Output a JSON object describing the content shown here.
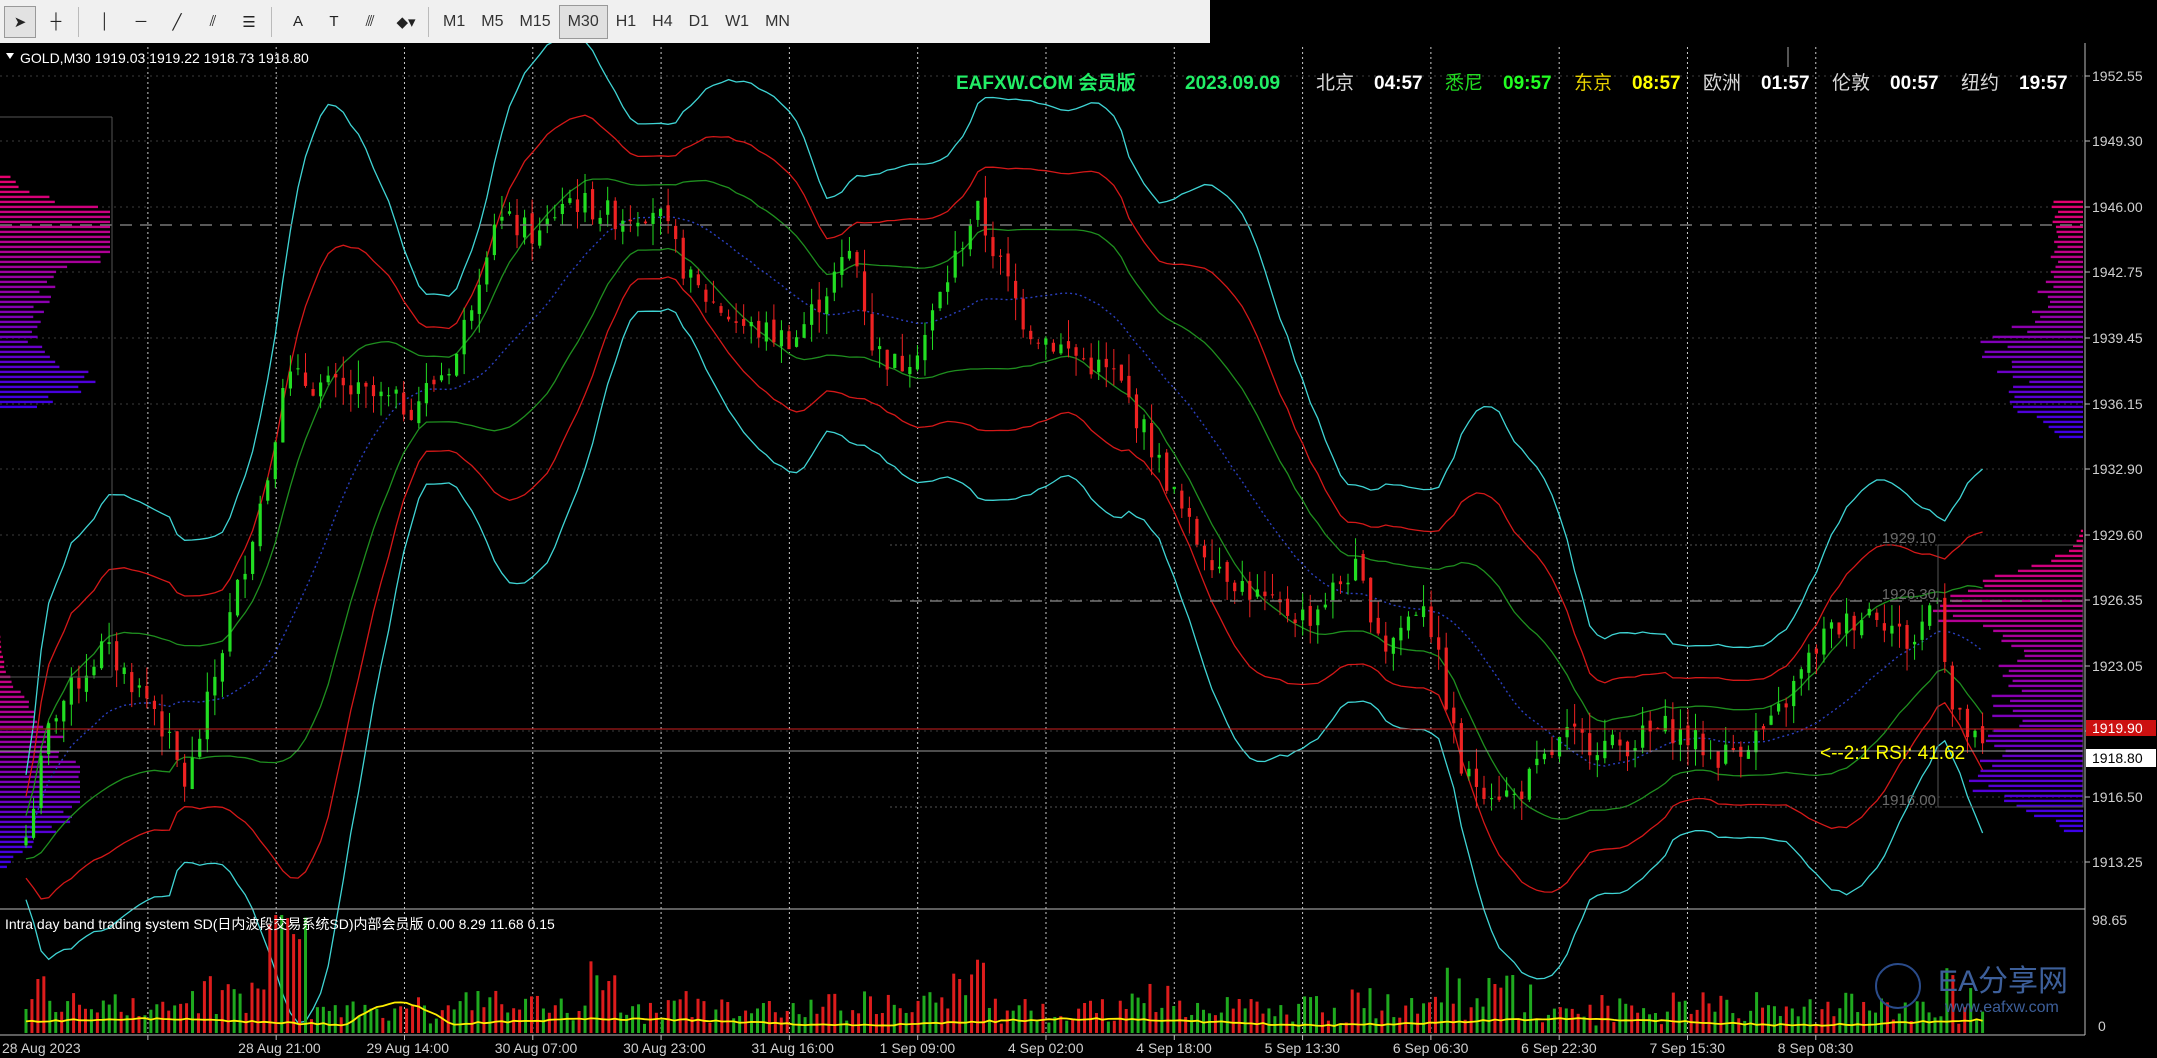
{
  "toolbar": {
    "tools": [
      {
        "name": "cursor-arrow-icon",
        "glyph": "➤"
      },
      {
        "name": "crosshair-icon",
        "glyph": "┼"
      },
      {
        "name": "vertical-line-icon",
        "glyph": "│"
      },
      {
        "name": "horizontal-line-icon",
        "glyph": "─"
      },
      {
        "name": "trendline-icon",
        "glyph": "╱"
      },
      {
        "name": "equidistant-channel-icon",
        "glyph": "⫽"
      },
      {
        "name": "fibonacci-icon",
        "glyph": "☰"
      },
      {
        "name": "text-icon",
        "glyph": "A"
      },
      {
        "name": "text-label-icon",
        "glyph": "T"
      },
      {
        "name": "parallel-lines-icon",
        "glyph": "⫻"
      },
      {
        "name": "shapes-menu-icon",
        "glyph": "◆▾"
      }
    ],
    "timeframes": [
      "M1",
      "M5",
      "M15",
      "M30",
      "H1",
      "H4",
      "D1",
      "W1",
      "MN"
    ],
    "active_timeframe": "M30"
  },
  "chart": {
    "header": "GOLD,M30  1919.03 1919.22 1918.73 1918.80",
    "brand": "EAFXW.COM 会员版",
    "date": "2023.09.09",
    "clocks": [
      {
        "city": "北京",
        "time": "04:57",
        "city_color": "#d8d8d8",
        "time_color": "#ffffff"
      },
      {
        "city": "悉尼",
        "time": "09:57",
        "city_color": "#22dd22",
        "time_color": "#22ff22"
      },
      {
        "city": "东京",
        "time": "08:57",
        "city_color": "#e6d000",
        "time_color": "#ffff00"
      },
      {
        "city": "欧洲",
        "time": "01:57",
        "city_color": "#d8d8d8",
        "time_color": "#ffffff"
      },
      {
        "city": "伦敦",
        "time": "00:57",
        "city_color": "#d8d8d8",
        "time_color": "#ffffff"
      },
      {
        "city": "纽约",
        "time": "19:57",
        "city_color": "#d8d8d8",
        "time_color": "#ffffff"
      }
    ],
    "rsi_label": "<--2:1  RSI: 41.62",
    "current_price": "1918.80",
    "red_price_tag": "1919.90",
    "level_labels": [
      "1929.10",
      "1926.30",
      "1916.00"
    ],
    "indicator_title": "Intra day band trading system SD(日内波段交易系统SD)内部会员版 0.00 8.29 11.68 0.15",
    "indicator_max": "98.65",
    "indicator_min": "0",
    "watermark_title": "EA分享网",
    "watermark_url": "www.eafxw.com"
  },
  "chart_data": {
    "type": "candlestick",
    "symbol": "GOLD",
    "timeframe": "M30",
    "ohlc_last": {
      "open": 1919.03,
      "high": 1919.22,
      "low": 1918.73,
      "close": 1918.8
    },
    "y_ticks": [
      1952.55,
      1949.3,
      1946.0,
      1942.75,
      1939.45,
      1936.15,
      1932.9,
      1929.6,
      1926.35,
      1923.05,
      1919.8,
      1916.5,
      1913.25
    ],
    "ylim": [
      1911.0,
      1954.0
    ],
    "x_ticks": [
      "28 Aug 2023",
      "28 Aug 21:00",
      "29 Aug 14:00",
      "30 Aug 07:00",
      "30 Aug 23:00",
      "31 Aug 16:00",
      "1 Sep 09:00",
      "4 Sep 02:00",
      "4 Sep 18:00",
      "5 Sep 13:30",
      "6 Sep 06:30",
      "6 Sep 22:30",
      "7 Sep 15:30",
      "8 Sep 08:30"
    ],
    "horizontal_levels": [
      1945.1,
      1926.3,
      1919.9,
      1918.8
    ],
    "price_path": [
      [
        0,
        1914.5
      ],
      [
        0.2,
        1920.5
      ],
      [
        0.6,
        1924.0
      ],
      [
        1.0,
        1921.0
      ],
      [
        1.25,
        1917.0
      ],
      [
        1.55,
        1924.5
      ],
      [
        1.9,
        1933.0
      ],
      [
        2.0,
        1937.5
      ],
      [
        2.5,
        1936.8
      ],
      [
        3.0,
        1936.0
      ],
      [
        3.35,
        1938.5
      ],
      [
        3.65,
        1945.5
      ],
      [
        4.0,
        1944.5
      ],
      [
        4.2,
        1946.5
      ],
      [
        4.6,
        1945.5
      ],
      [
        4.9,
        1946.0
      ],
      [
        5.2,
        1942.0
      ],
      [
        5.6,
        1940.0
      ],
      [
        5.9,
        1939.5
      ],
      [
        6.0,
        1939.5
      ],
      [
        6.2,
        1941.5
      ],
      [
        6.45,
        1944.0
      ],
      [
        6.6,
        1939.0
      ],
      [
        6.8,
        1938.0
      ],
      [
        7.0,
        1939.5
      ],
      [
        7.4,
        1946.0
      ],
      [
        7.8,
        1940.0
      ],
      [
        8.2,
        1938.5
      ],
      [
        8.5,
        1937.5
      ],
      [
        8.7,
        1935.0
      ],
      [
        9.1,
        1929.5
      ],
      [
        9.4,
        1927.5
      ],
      [
        9.7,
        1926.0
      ],
      [
        10.0,
        1925.5
      ],
      [
        10.35,
        1928.0
      ],
      [
        10.6,
        1924.0
      ],
      [
        10.9,
        1926.5
      ],
      [
        11.2,
        1917.5
      ],
      [
        11.6,
        1916.5
      ],
      [
        12.0,
        1919.5
      ],
      [
        12.4,
        1919.0
      ],
      [
        12.8,
        1920.0
      ],
      [
        13.2,
        1918.5
      ],
      [
        13.6,
        1920.0
      ],
      [
        14.0,
        1924.5
      ],
      [
        14.4,
        1926.0
      ],
      [
        14.7,
        1924.0
      ],
      [
        14.9,
        1927.0
      ],
      [
        15.0,
        1921.0
      ],
      [
        15.15,
        1919.5
      ],
      [
        15.25,
        1918.8
      ]
    ],
    "rsi": 41.62,
    "indicator": {
      "name": "Intra day band trading system SD",
      "values": [
        0.0,
        8.29,
        11.68,
        0.15
      ],
      "range": [
        0,
        98.65
      ]
    }
  }
}
